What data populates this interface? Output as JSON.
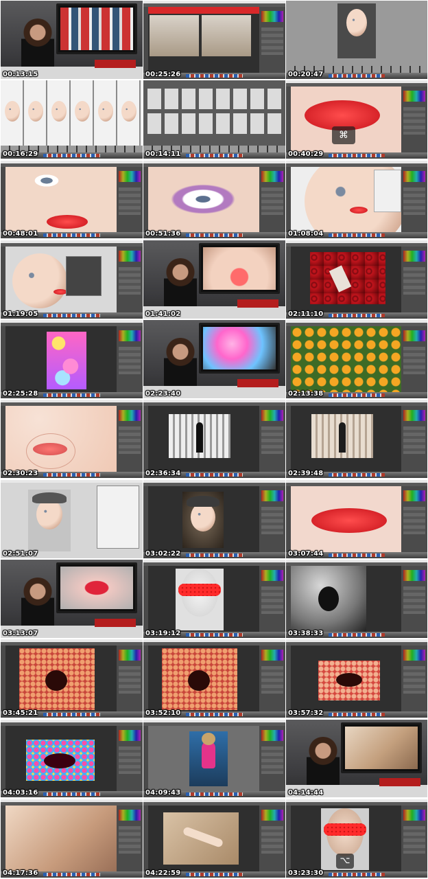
{
  "thumbnails": [
    {
      "time": "00:13:15",
      "scene": "studio"
    },
    {
      "time": "00:25:26",
      "scene": "photoshop-two-photos"
    },
    {
      "time": "00:20:47",
      "scene": "photoshop-portrait-gray"
    },
    {
      "time": "00:16:29",
      "scene": "contact-strip"
    },
    {
      "time": "00:14:11",
      "scene": "grid-thumbnails"
    },
    {
      "time": "00:40:29",
      "scene": "photoshop-lips-closeup"
    },
    {
      "time": "00:48:01",
      "scene": "photoshop-face-closeup"
    },
    {
      "time": "00:51:36",
      "scene": "photoshop-eye-closeup"
    },
    {
      "time": "01:08:04",
      "scene": "photoshop-portrait-dialog"
    },
    {
      "time": "01:19:05",
      "scene": "photoshop-face-side"
    },
    {
      "time": "01:41:02",
      "scene": "studio-smile"
    },
    {
      "time": "02:11:10",
      "scene": "photoshop-red-flowers"
    },
    {
      "time": "02:25:28",
      "scene": "photoshop-bokeh"
    },
    {
      "time": "02:23:40",
      "scene": "studio-bokeh"
    },
    {
      "time": "02:13:38",
      "scene": "photoshop-orange-flowers"
    },
    {
      "time": "02:30:23",
      "scene": "photoshop-lips-face"
    },
    {
      "time": "02:36:34",
      "scene": "photoshop-bw-figure"
    },
    {
      "time": "02:39:48",
      "scene": "photoshop-color-figure"
    },
    {
      "time": "02:51:07",
      "scene": "photoshop-man-cap"
    },
    {
      "time": "03:02:22",
      "scene": "photoshop-man-cap-dark"
    },
    {
      "time": "03:07:44",
      "scene": "photoshop-red-lips"
    },
    {
      "time": "03:13:07",
      "scene": "studio-lips"
    },
    {
      "time": "03:19:12",
      "scene": "photoshop-glasses"
    },
    {
      "time": "03:38:33",
      "scene": "photoshop-open-mouth-bw"
    },
    {
      "time": "03:45:21",
      "scene": "photoshop-floral-mouth"
    },
    {
      "time": "03:52:10",
      "scene": "photoshop-floral-mouth"
    },
    {
      "time": "03:57:32",
      "scene": "photoshop-floral-lips"
    },
    {
      "time": "04:03:16",
      "scene": "photoshop-colorful-lips"
    },
    {
      "time": "04:09:43",
      "scene": "photoshop-pink-girl"
    },
    {
      "time": "04:14:44",
      "scene": "studio-photo"
    },
    {
      "time": "04:17:36",
      "scene": "photoshop-legs"
    },
    {
      "time": "04:22:59",
      "scene": "photoshop-reclining"
    },
    {
      "time": "03:23:30",
      "scene": "photoshop-glasses-2"
    }
  ]
}
